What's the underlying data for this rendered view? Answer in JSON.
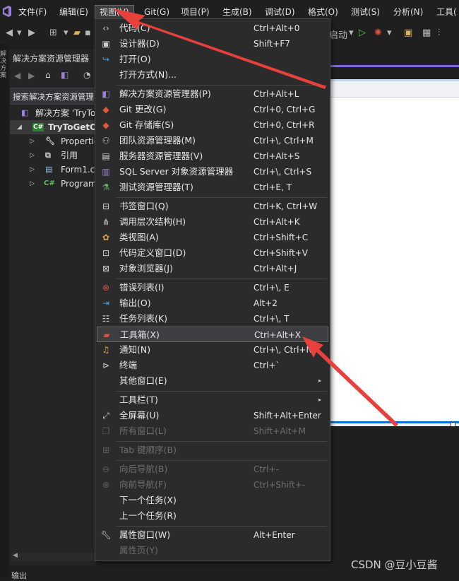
{
  "menubar": {
    "items": [
      "文件(F)",
      "编辑(E)",
      "视图(V)",
      "Git(G)",
      "项目(P)",
      "生成(B)",
      "调试(D)",
      "格式(O)",
      "测试(S)",
      "分析(N)",
      "工具("
    ]
  },
  "toolbar": {
    "start_label": "启动"
  },
  "left_strip": [
    "解",
    "决",
    "方",
    "案"
  ],
  "solution_explorer": {
    "title": "解决方案资源管理器",
    "search_placeholder": "搜索解决方案资源管理",
    "tree": [
      {
        "label": "解决方案 'TryTo",
        "icon": "solution-icon"
      },
      {
        "label": "TryToGetO",
        "icon": "csharp-project-icon"
      },
      {
        "label": "Propertie",
        "icon": "wrench-icon"
      },
      {
        "label": "引用",
        "icon": "references-icon"
      },
      {
        "label": "Form1.c",
        "icon": "form-icon"
      },
      {
        "label": "Program",
        "icon": "csharp-file-icon",
        "icon_text": "C#"
      }
    ],
    "project_badge": "C#"
  },
  "view_menu": {
    "items": [
      {
        "label": "代码(C)",
        "shortcut": "Ctrl+Alt+0",
        "icon": "code-icon"
      },
      {
        "label": "设计器(D)",
        "shortcut": "Shift+F7",
        "icon": "designer-icon"
      },
      {
        "label": "打开(O)",
        "shortcut": "",
        "icon": "open-icon"
      },
      {
        "label": "打开方式(N)...",
        "shortcut": "",
        "icon": ""
      },
      {
        "label": "解决方案资源管理器(P)",
        "shortcut": "Ctrl+Alt+L",
        "icon": "solution-explorer-icon"
      },
      {
        "label": "Git 更改(G)",
        "shortcut": "Ctrl+0, Ctrl+G",
        "icon": "git-changes-icon"
      },
      {
        "label": "Git 存储库(S)",
        "shortcut": "Ctrl+0, Ctrl+R",
        "icon": "git-repository-icon"
      },
      {
        "label": "团队资源管理器(M)",
        "shortcut": "Ctrl+\\, Ctrl+M",
        "icon": "team-explorer-icon"
      },
      {
        "label": "服务器资源管理器(V)",
        "shortcut": "Ctrl+Alt+S",
        "icon": "server-explorer-icon"
      },
      {
        "label": "SQL Server 对象资源管理器",
        "shortcut": "Ctrl+\\, Ctrl+S",
        "icon": "sql-server-icon"
      },
      {
        "label": "测试资源管理器(T)",
        "shortcut": "Ctrl+E, T",
        "icon": "test-explorer-icon"
      },
      {
        "label": "书签窗口(Q)",
        "shortcut": "Ctrl+K, Ctrl+W",
        "icon": "bookmark-icon"
      },
      {
        "label": "调用层次结构(H)",
        "shortcut": "Ctrl+Alt+K",
        "icon": "call-hierarchy-icon"
      },
      {
        "label": "类视图(A)",
        "shortcut": "Ctrl+Shift+C",
        "icon": "class-view-icon"
      },
      {
        "label": "代码定义窗口(D)",
        "shortcut": "Ctrl+Shift+V",
        "icon": "code-definition-icon"
      },
      {
        "label": "对象浏览器(J)",
        "shortcut": "Ctrl+Alt+J",
        "icon": "object-browser-icon"
      },
      {
        "label": "错误列表(I)",
        "shortcut": "Ctrl+\\, E",
        "icon": "error-list-icon"
      },
      {
        "label": "输出(O)",
        "shortcut": "Alt+2",
        "icon": "output-icon"
      },
      {
        "label": "任务列表(K)",
        "shortcut": "Ctrl+\\, T",
        "icon": "task-list-icon"
      },
      {
        "label": "工具箱(X)",
        "shortcut": "Ctrl+Alt+X",
        "icon": "toolbox-icon"
      },
      {
        "label": "通知(N)",
        "shortcut": "Ctrl+\\, Ctrl+N",
        "icon": "bell-icon"
      },
      {
        "label": "终端",
        "shortcut": "Ctrl+`",
        "icon": "terminal-icon"
      },
      {
        "label": "其他窗口(E)",
        "shortcut": "",
        "icon": ""
      },
      {
        "label": "工具栏(T)",
        "shortcut": "",
        "icon": ""
      },
      {
        "label": "全屏幕(U)",
        "shortcut": "Shift+Alt+Enter",
        "icon": "fullscreen-icon"
      },
      {
        "label": "所有窗口(L)",
        "shortcut": "Shift+Alt+M",
        "icon": "all-windows-icon"
      },
      {
        "label": "Tab 键顺序(B)",
        "shortcut": "",
        "icon": "tab-order-icon"
      },
      {
        "label": "向后导航(B)",
        "shortcut": "Ctrl+-",
        "icon": "navigate-back-icon"
      },
      {
        "label": "向前导航(F)",
        "shortcut": "Ctrl+Shift+-",
        "icon": "navigate-forward-icon"
      },
      {
        "label": "下一个任务(X)",
        "shortcut": "",
        "icon": ""
      },
      {
        "label": "上一个任务(R)",
        "shortcut": "",
        "icon": ""
      },
      {
        "label": "属性窗口(W)",
        "shortcut": "Alt+Enter",
        "icon": "wrench-icon"
      },
      {
        "label": "属性页(Y)",
        "shortcut": "",
        "icon": ""
      }
    ],
    "highlighted": "工具箱(X)",
    "submenu_arrow": "▸"
  },
  "bottom": {
    "output_tab": "输出"
  },
  "watermark": "CSDN @豆小豆酱",
  "colors": {
    "accent": "#8068d8",
    "annotation_arrow": "#e8403a",
    "menu_bg": "#2b2b2b"
  }
}
